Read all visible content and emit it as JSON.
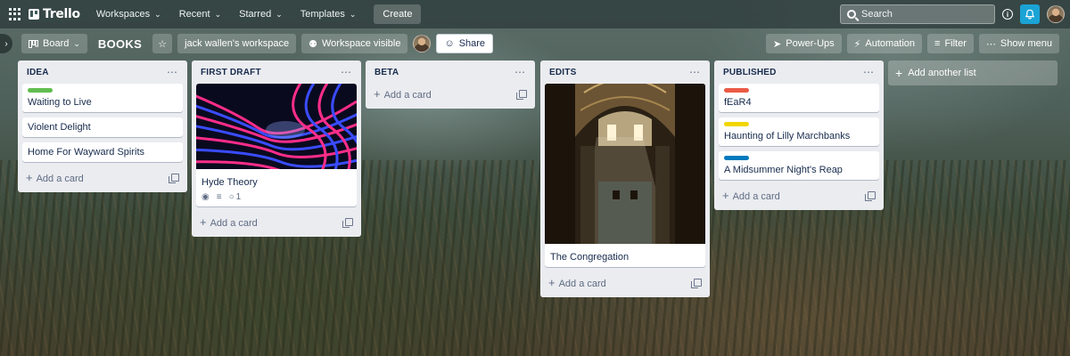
{
  "topbar": {
    "logo_text": "Trello",
    "nav": [
      {
        "label": "Workspaces"
      },
      {
        "label": "Recent"
      },
      {
        "label": "Starred"
      },
      {
        "label": "Templates"
      }
    ],
    "create_label": "Create",
    "search_placeholder": "Search",
    "bell_color": "#1ba3d6"
  },
  "board": {
    "view_label": "Board",
    "title": "BOOKS",
    "workspace_label": "jack wallen's workspace",
    "visibility_label": "Workspace visible",
    "share_label": "Share",
    "powerups_label": "Power-Ups",
    "automation_label": "Automation",
    "filter_label": "Filter",
    "menu_label": "Show menu"
  },
  "lists": [
    {
      "title": "IDEA",
      "cards": [
        {
          "title": "Waiting to Live",
          "label_color": "#61bd4f"
        },
        {
          "title": "Violent Delight"
        },
        {
          "title": "Home For Wayward Spirits"
        }
      ],
      "add_label": "Add a card"
    },
    {
      "title": "FIRST DRAFT",
      "cards": [
        {
          "title": "Hyde Theory",
          "cover": "abstract-wave-image",
          "comments": "1"
        }
      ],
      "add_label": "Add a card"
    },
    {
      "title": "BETA",
      "cards": [],
      "add_label": "Add a card"
    },
    {
      "title": "EDITS",
      "cards": [
        {
          "title": "The Congregation",
          "cover": "cathedral-interior-image"
        }
      ],
      "add_label": "Add a card"
    },
    {
      "title": "PUBLISHED",
      "cards": [
        {
          "title": "fEaR4",
          "label_color": "#eb5a46"
        },
        {
          "title": "Haunting of Lilly Marchbanks",
          "label_color": "#f2d600"
        },
        {
          "title": "A Midsummer Night's Reap",
          "label_color": "#0079bf"
        }
      ],
      "add_label": "Add a card"
    }
  ],
  "add_list_label": "Add another list"
}
